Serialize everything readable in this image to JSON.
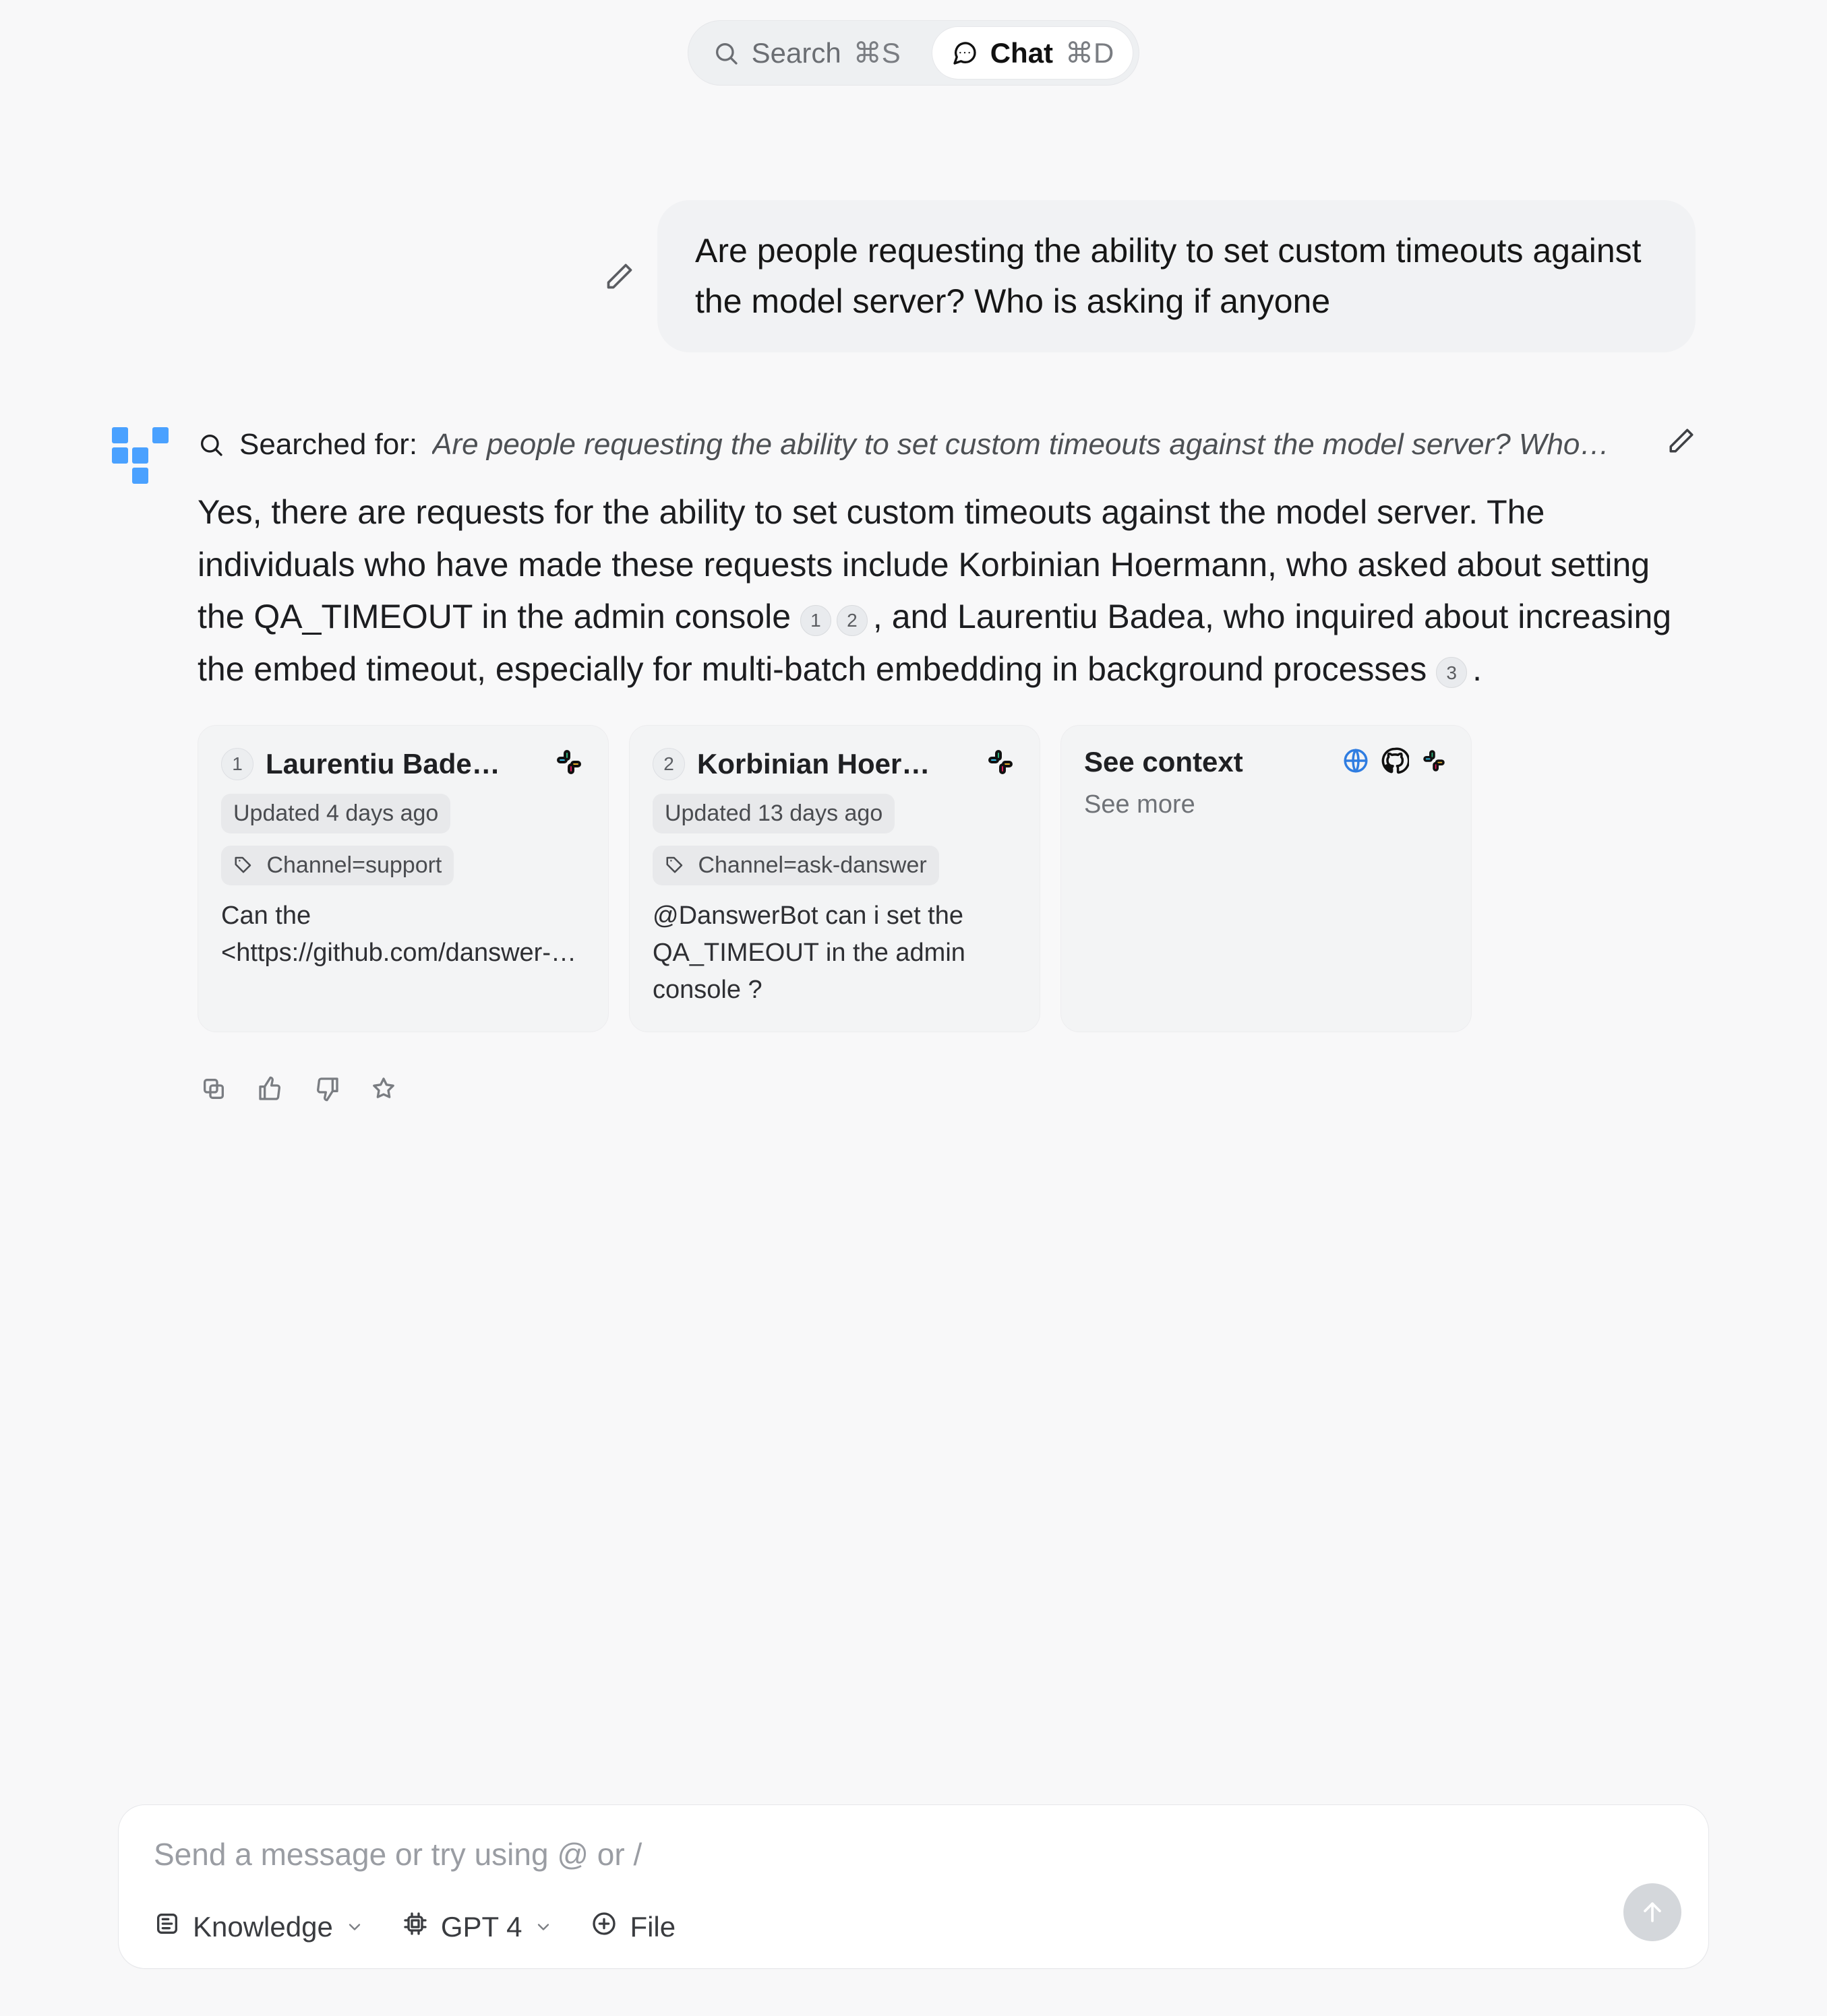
{
  "top": {
    "search_label": "Search",
    "search_shortcut": "⌘S",
    "chat_label": "Chat",
    "chat_shortcut": "⌘D"
  },
  "user_message": "Are people requesting the ability to set custom timeouts against the model server? Who is asking if anyone",
  "search": {
    "prefix": "Searched for:",
    "query": "Are people requesting the ability to set custom timeouts against the model server? Who…"
  },
  "answer": {
    "p1": "Yes, there are requests for the ability to set custom timeouts against the model server. The individuals who have made these requests include Korbinian Hoermann, who asked about setting the QA_TIMEOUT in the admin console ",
    "c12a": "1",
    "c12b": "2",
    "p2": ", and Laurentiu Badea, who inquired about increasing the embed timeout, especially for multi-batch embedding in background processes ",
    "c3": "3",
    "p3": "."
  },
  "cards": [
    {
      "num": "1",
      "title": "Laurentiu Bade…",
      "updated": "Updated 4 days ago",
      "channel": "Channel=support",
      "snippet": "Can the <https://github.com/danswer-…"
    },
    {
      "num": "2",
      "title": "Korbinian Hoer…",
      "updated": "Updated 13 days ago",
      "channel": "Channel=ask-danswer",
      "snippet": "@DanswerBot can i set the QA_TIMEOUT in the admin console ?"
    }
  ],
  "context": {
    "title": "See context",
    "more": "See more"
  },
  "composer": {
    "placeholder": "Send a message or try using @ or /",
    "knowledge": "Knowledge",
    "model": "GPT 4",
    "file": "File"
  }
}
